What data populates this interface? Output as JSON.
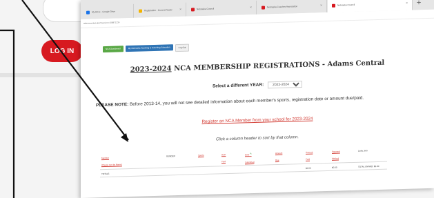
{
  "back": {
    "login_label": "LOG IN"
  },
  "tabs": [
    {
      "label": "My Drive - Google Drive",
      "icon": "google-drive-icon",
      "color": "#1a73e8"
    },
    {
      "label": "Registration - Current Roster",
      "icon": "document-icon",
      "color": "#f4b400"
    },
    {
      "label": "Nebraska Council",
      "icon": "n-logo-icon",
      "color": "#d71920"
    },
    {
      "label": "Nebraska Coaches Association",
      "icon": "n-logo-icon",
      "color": "#d71920"
    },
    {
      "label": "Nebraska Council",
      "icon": "n-logo-icon",
      "color": "#d71920"
    }
  ],
  "new_tab_label": "+",
  "address": "adamscentral.php?session=108871234",
  "buttons": {
    "home": "NCA Dashboard",
    "teaching": "My Nebraska Teaching & Coaching Education",
    "log_out": "Log Out"
  },
  "page": {
    "title_year": "2023-2024",
    "title_rest": "NCA MEMBERSHIP REGISTRATIONS - Adams Central",
    "select_label": "Select a different YEAR:",
    "select_value": "2023-2024",
    "note_label": "PLEASE NOTE:",
    "note_text": "Before 2013-14, you will not see detailed information about each member's sports, registration date or amount due/paid.",
    "register_link": "Register an NCA Member from your school for 2023-2024",
    "sort_hint": "Click a column header to sort by that column."
  },
  "table": {
    "headers": [
      {
        "label": "Member",
        "sub": "(Please sort by Name)",
        "link": true
      },
      {
        "label": "GENDER",
        "sub": "",
        "link": false
      },
      {
        "label": "Sports",
        "sub": "",
        "link": true
      },
      {
        "label": "Date",
        "sub": "Paid",
        "link": true
      },
      {
        "label": "Date",
        "sub": "Submitted",
        "link": true
      },
      {
        "label": "Amount",
        "sub": "Due",
        "link": true
      },
      {
        "label": "Amount",
        "sub": "Paid",
        "link": true
      },
      {
        "label": "Payment",
        "sub": "Method",
        "link": true
      },
      {
        "label": "Links, Info",
        "sub": "",
        "link": false
      }
    ],
    "totals": {
      "label": "TOTALS",
      "paid": "$0.00",
      "method": "$0.00",
      "unpaid": "TOTAL UNPAID: $0.00"
    }
  }
}
